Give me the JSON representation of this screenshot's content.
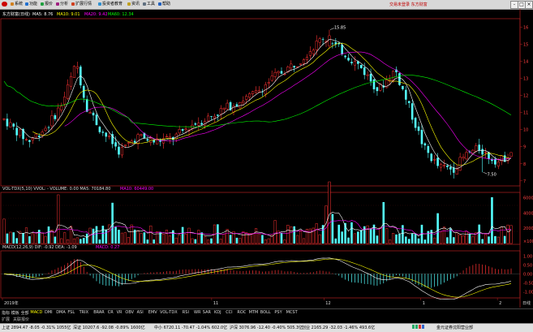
{
  "menu": {
    "items": [
      "系统",
      "功能",
      "报价",
      "分析",
      "扩展行情",
      "投资者教育",
      "资讯",
      "工具",
      "帮助"
    ],
    "brand": "交易未登录  东方财富"
  },
  "window_buttons": [
    "-",
    "□",
    "×"
  ],
  "header": {
    "stock": "东方财富(日线)",
    "ma5": "MA5: 8.76",
    "ma10": "MA10: 9.01",
    "ma20": "MA20: 9.42",
    "ma60": "MA60: 12.34"
  },
  "price_axis": [
    "16",
    "15",
    "14",
    "13",
    "12",
    "11",
    "10",
    "9",
    "8",
    "7"
  ],
  "annotations": {
    "high": "15.85",
    "low": "7.50"
  },
  "vol": {
    "title": "VOL-TDX(5,10)  VVOL: -  VOLUME: 0.00  MA5: 70184.80",
    "ma10": "MA10: 60449.00",
    "axis": [
      "600000",
      "400000",
      "200000"
    ],
    "unit": "×100"
  },
  "macd": {
    "title": "MACD(12,26,9)  DIF: -0.92  DEA: -1.09",
    "value": "MACD: 0.27",
    "axis": [
      "1.00",
      "0.50",
      "0.00",
      "-0.50",
      "-1.00"
    ]
  },
  "date_axis": {
    "labels": [
      "2019年",
      "11",
      "12",
      "1",
      "2"
    ],
    "extra": "日线"
  },
  "colors": {
    "up": "#ff3232",
    "down": "#54ffff",
    "ma5": "#ffffff",
    "ma10": "#ffff00",
    "ma20": "#ff00ff",
    "ma60": "#00ff00"
  },
  "tabs": [
    "指标",
    "模板",
    "全部",
    "MACD",
    "DMI",
    "DMA",
    "FSL",
    "TRIX",
    "BRAR",
    "CR",
    "VR",
    "OBV",
    "ASI",
    "EMV",
    "VOL-TDX",
    "RSI",
    "WR",
    "SAR",
    "KDJ",
    "CCI",
    "ROC",
    "MTM",
    "BOLL",
    "PSY",
    "MCST"
  ],
  "subtabs": [
    "扩展",
    "关联报价"
  ],
  "status": [
    {
      "text": "上证 2894.47  -8.05  -0.31%  1055亿"
    },
    {
      "text": "深证 10207.6  -92.08  -0.89%  1600亿"
    },
    {
      "text": "中小 6720.11  -70.47  -1.04%  602.0亿"
    },
    {
      "text": "沪深 3076.96  -12.40  -0.40%  505.3亿"
    },
    {
      "text": "创业 2165.29  -32.03  -1.46%  493.6亿"
    }
  ],
  "connection": "金元证券沈阳营业部"
}
